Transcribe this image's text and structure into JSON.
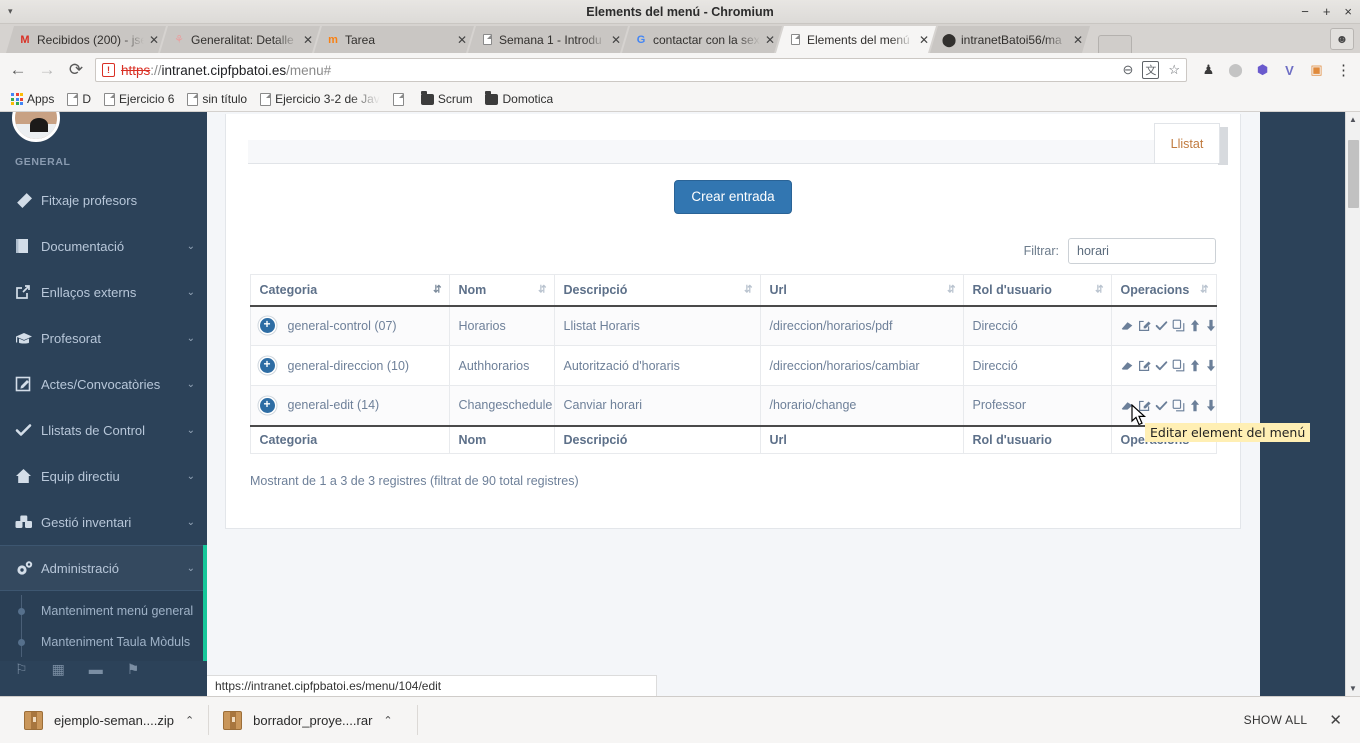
{
  "window": {
    "title": "Elements del menú - Chromium",
    "minimize": "−",
    "maximize": "+",
    "close": "×",
    "tablist_caret": "▾"
  },
  "tabs": [
    {
      "label": "Recibidos (200) - jse",
      "favicon": "gmail-icon",
      "glyph": "M",
      "active": false
    },
    {
      "label": "Generalitat: Detalle ",
      "favicon": "generalitat-icon",
      "glyph": "⚘",
      "active": false
    },
    {
      "label": "Tarea",
      "favicon": "moodle-icon",
      "glyph": "m",
      "active": false
    },
    {
      "label": "Semana 1 - Introdu",
      "favicon": "page-icon",
      "glyph": "▤",
      "active": false
    },
    {
      "label": "contactar con la sex",
      "favicon": "google-icon",
      "glyph": "G",
      "active": false
    },
    {
      "label": "Elements del menú",
      "favicon": "page-icon",
      "glyph": "▤",
      "active": true
    },
    {
      "label": "intranetBatoi56/ma",
      "favicon": "github-icon",
      "glyph": "●",
      "active": false
    }
  ],
  "toolbar": {
    "back_icon": "←",
    "forward_icon": "→",
    "reload_icon": "⟳",
    "security_icon": "not-secure-icon",
    "url_scheme": "https",
    "url_sep": "://",
    "url_host": "intranet.cipfpbatoi.es",
    "url_path": "/menu#",
    "zoom_out_icon": "⊖",
    "translate_icon": "文",
    "bookmark_star_icon": "☆",
    "extensions": [
      "evernote-icon",
      "grey-circle-icon",
      "r-badge-icon",
      "v-icon",
      "vault-icon"
    ],
    "menu_icon": "⋮"
  },
  "bookmarks": [
    {
      "label": "Apps",
      "icon": "apps-grid-icon"
    },
    {
      "label": "D",
      "icon": "page-icon"
    },
    {
      "label": "Ejercicio 6",
      "icon": "page-icon"
    },
    {
      "label": "sin título",
      "icon": "page-icon"
    },
    {
      "label": "Ejercicio 3-2 de Jav",
      "icon": "page-icon"
    },
    {
      "label": "",
      "icon": "page-icon"
    },
    {
      "label": "Scrum",
      "icon": "folder-icon"
    },
    {
      "label": "Domotica",
      "icon": "folder-icon"
    }
  ],
  "sidebar": {
    "section_label": "GENERAL",
    "items": [
      {
        "label": "Fitxaje profesors",
        "icon": "ribbon-icon",
        "glyph": "◈",
        "chevron": false
      },
      {
        "label": "Documentació",
        "icon": "book-icon",
        "glyph": "▤",
        "chevron": true
      },
      {
        "label": "Enllaços externs",
        "icon": "external-link-icon",
        "glyph": "↗",
        "chevron": true
      },
      {
        "label": "Profesorat",
        "icon": "graduation-cap-icon",
        "glyph": "🎓",
        "chevron": true
      },
      {
        "label": "Actes/Convocatòries",
        "icon": "edit-square-icon",
        "glyph": "✎",
        "chevron": true
      },
      {
        "label": "Llistats de Control",
        "icon": "check-icon",
        "glyph": "✔",
        "chevron": true
      },
      {
        "label": "Equip directiu",
        "icon": "home-icon",
        "glyph": "⌂",
        "chevron": true
      },
      {
        "label": "Gestió inventari",
        "icon": "boxes-icon",
        "glyph": "◰",
        "chevron": true
      },
      {
        "label": "Administració",
        "icon": "gears-icon",
        "glyph": "⚙",
        "chevron": true,
        "active": true
      }
    ],
    "subitems": [
      {
        "label": "Manteniment menú general"
      },
      {
        "label": "Manteniment Taula Mòduls"
      }
    ],
    "chevron_glyph": "⌄"
  },
  "main": {
    "active_tab_label": "Llistat",
    "create_button": "Crear entrada",
    "filter_label": "Filtrar:",
    "filter_value": "horari",
    "filter_placeholder": "",
    "info_text": "Mostrant de 1 a 3 de 3 registres (filtrat de 90 total registres)",
    "columns": [
      {
        "label": "Categoria",
        "sorted": true
      },
      {
        "label": "Nom",
        "sorted": false
      },
      {
        "label": "Descripció",
        "sorted": false
      },
      {
        "label": "Url",
        "sorted": false
      },
      {
        "label": "Rol d'usuario",
        "sorted": false
      },
      {
        "label": "Operacions",
        "sorted": false
      }
    ],
    "rows": [
      {
        "categoria": "general-control (07)",
        "nom": "Horarios",
        "descripcio": "Llistat Horaris",
        "url": "/direccion/horarios/pdf",
        "rol": "Direcció"
      },
      {
        "categoria": "general-direccion (10)",
        "nom": "Authhorarios",
        "descripcio": "Autorització d'horaris",
        "url": "/direccion/horarios/cambiar",
        "rol": "Direcció"
      },
      {
        "categoria": "general-edit (14)",
        "nom": "Changeschedule",
        "descripcio": "Canviar horari",
        "url": "/horario/change",
        "rol": "Professor"
      }
    ],
    "operation_icons": [
      "eraser-icon",
      "edit-icon",
      "check-icon",
      "clone-icon",
      "arrow-up-icon",
      "arrow-down-icon"
    ],
    "expand_badge": "+"
  },
  "tooltip": {
    "text": "Editar element del menú"
  },
  "status_bar": {
    "url": "https://intranet.cipfpbatoi.es/menu/104/edit"
  },
  "downloads": {
    "items": [
      {
        "name": "ejemplo-seman....zip",
        "caret": "⌃"
      },
      {
        "name": "borrador_proye....rar",
        "caret": "⌃"
      }
    ],
    "show_all": "SHOW ALL",
    "close": "✕"
  },
  "colors": {
    "sidebar_bg": "#2c4259",
    "accent_green": "#16c79a",
    "primary_button": "#3276b1",
    "tab_text_orange": "#c07a3e",
    "tooltip_bg": "#ffefb4"
  }
}
